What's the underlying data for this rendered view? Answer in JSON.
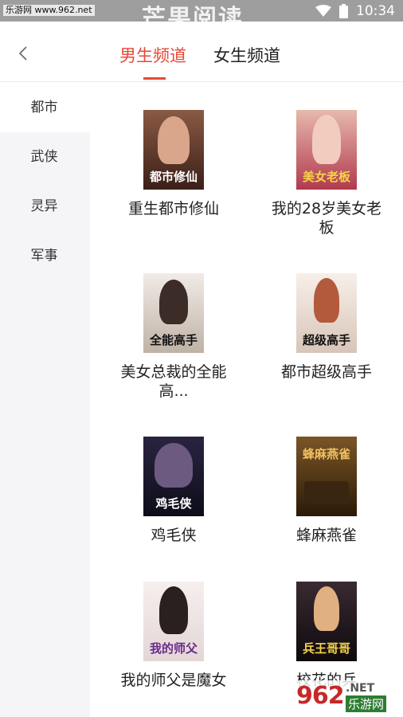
{
  "status": {
    "site": "乐游网 www.962.net",
    "app_watermark": "芒果阅读",
    "time": "10:34"
  },
  "tabs": [
    {
      "label": "男生频道",
      "active": true
    },
    {
      "label": "女生频道",
      "active": false
    }
  ],
  "sidebar": {
    "items": [
      {
        "label": "都市",
        "active": true
      },
      {
        "label": "武侠",
        "active": false
      },
      {
        "label": "灵异",
        "active": false
      },
      {
        "label": "军事",
        "active": false
      }
    ]
  },
  "books": [
    {
      "title": "重生都市修仙",
      "cover_text": "都市修仙",
      "cover_color": "#6b3b2a"
    },
    {
      "title": "我的28岁美女老板",
      "cover_text": "美女老板",
      "cover_color": "#c2455a"
    },
    {
      "title": "美女总裁的全能高...",
      "cover_text": "全能高手",
      "cover_color": "#d9cfc6"
    },
    {
      "title": "都市超级高手",
      "cover_text": "超级高手",
      "cover_color": "#e7ddd4"
    },
    {
      "title": "鸡毛侠",
      "cover_text": "鸡毛侠",
      "cover_color": "#1b1b2e"
    },
    {
      "title": "蜂麻燕雀",
      "cover_text": "蜂麻燕雀",
      "cover_color": "#4a2f14"
    },
    {
      "title": "我的师父是魔女",
      "cover_text": "我的师父",
      "cover_color": "#efe6e6"
    },
    {
      "title": "校花的兵",
      "cover_text": "兵王哥哥",
      "cover_color": "#1e1720"
    }
  ],
  "watermark": {
    "number": "962",
    "net": ".NET",
    "cn": "乐游网"
  },
  "colors": {
    "accent": "#e34a3a",
    "sidebar_bg": "#f5f5f7"
  }
}
